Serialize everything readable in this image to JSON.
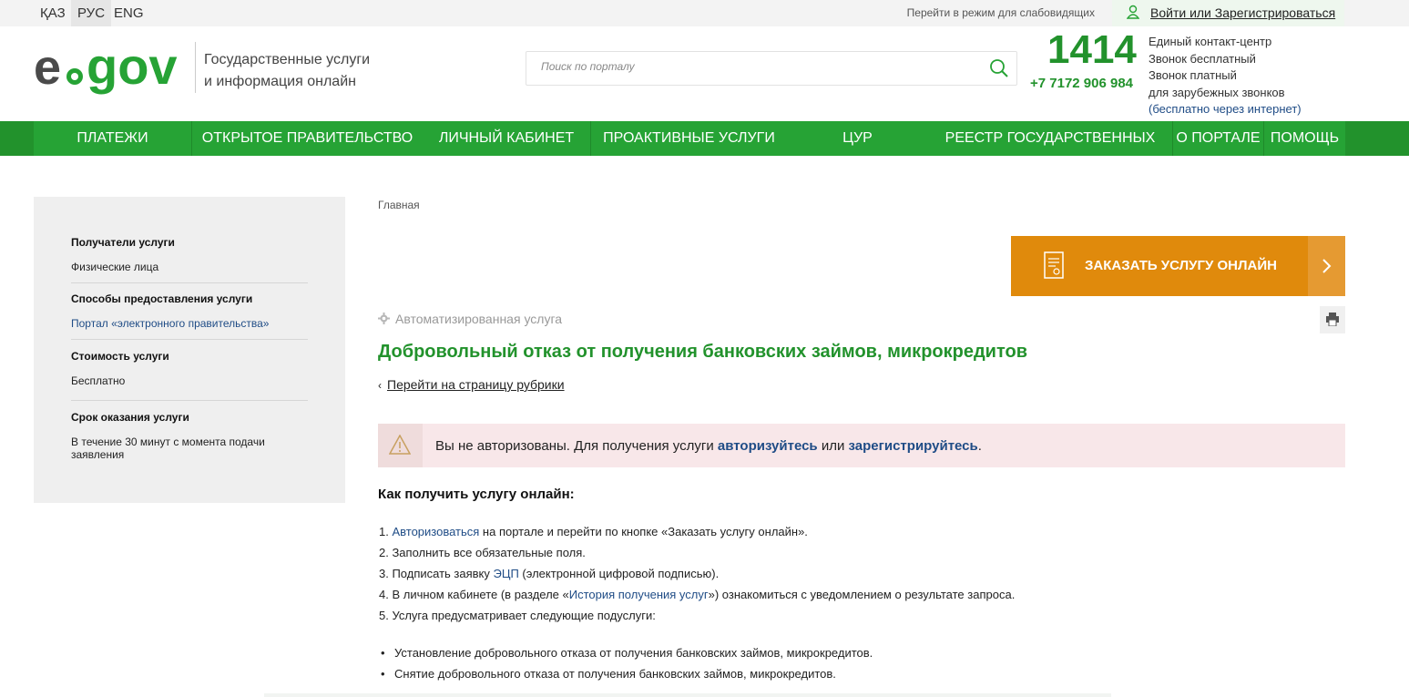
{
  "topbar": {
    "languages": [
      "ҚАЗ",
      "РУС",
      "ENG"
    ],
    "low_vision": "Перейти в режим для слабовидящих",
    "login": "Войти или Зарегистрироваться"
  },
  "header": {
    "tagline_line1": "Государственные услуги",
    "tagline_line2": "и информация онлайн",
    "search_placeholder": "Поиск по порталу",
    "contact_number": "1414",
    "phone": "+7 7172 906 984",
    "contact_lines": [
      "Единый контакт-центр",
      "Звонок бесплатный",
      "Звонок платный",
      "для зарубежных звонков"
    ],
    "contact_internet": "(бесплатно через интернет)"
  },
  "nav": {
    "items": [
      "ПЛАТЕЖИ",
      "ОТКРЫТОЕ ПРАВИТЕЛЬСТВО",
      "ЛИЧНЫЙ КАБИНЕТ",
      "ПРОАКТИВНЫЕ УСЛУГИ",
      "ЦУР",
      "РЕЕСТР ГОСУДАРСТВЕННЫХ УСЛУГ",
      "О ПОРТАЛЕ",
      "ПОМОЩЬ"
    ]
  },
  "sidebar": {
    "recipients_h": "Получатели услуги",
    "recipients_v": "Физические лица",
    "methods_h": "Способы предоставления услуги",
    "methods_v": "Портал «электронного правительства»",
    "cost_h": "Стоимость услуги",
    "cost_v": "Бесплатно",
    "term_h": "Срок оказания услуги",
    "term_v1": "В течение 30 минут с момента подачи",
    "term_v2": "заявления"
  },
  "main": {
    "breadcrumb": "Главная",
    "order_button": "ЗАКАЗАТЬ УСЛУГУ ОНЛАЙН",
    "auto_label": "Автоматизированная услуга",
    "title": "Добровольный отказ от получения банковских займов, микрокредитов",
    "back_link": "Перейти на страницу рубрики",
    "alert": {
      "text1": "Вы не авторизованы. Для получения услуги ",
      "link1": "авторизуйтесь",
      "text2": " или ",
      "link2": "зарегистрируйтесь",
      "text3": "."
    },
    "how_title": "Как получить услугу онлайн:",
    "step1_num": "1. ",
    "step1_link": "Авторизоваться",
    "step1_rest": " на портале и перейти по кнопке «Заказать услугу онлайн».",
    "step2": "2. Заполнить все обязательные поля.",
    "step3_pre": "3. Подписать заявку ",
    "step3_link": "ЭЦП",
    "step3_rest": " (электронной цифровой подписью).",
    "step4_pre": "4. В личном кабинете (в разделе «",
    "step4_link": "История получения услуг",
    "step4_rest": "») ознакомиться с уведомлением о результате запроса.",
    "step5": "5. Услуга предусматривает следующие подуслуги:",
    "bullet1": "Установление добровольного отказа от получения банковских займов, микрокредитов.",
    "bullet2": "Снятие добровольного отказа от получения банковских займов, микрокредитов."
  },
  "colors": {
    "green": "#22922c",
    "orange": "#e08a0c",
    "link_blue": "#1f4c86",
    "alert_bg": "#f8e7e9"
  }
}
